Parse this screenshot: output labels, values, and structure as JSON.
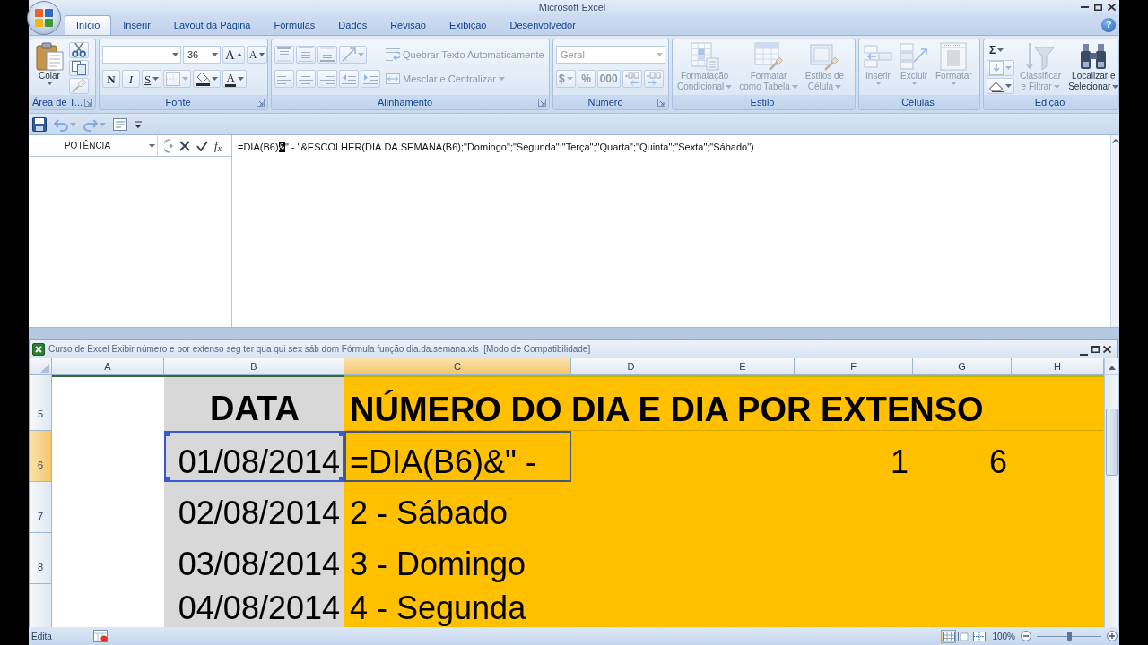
{
  "app": {
    "title": "Microsoft Excel",
    "help": "?"
  },
  "tabs": [
    {
      "label": "Início",
      "selected": true
    },
    {
      "label": "Inserir",
      "selected": false
    },
    {
      "label": "Layout da Página",
      "selected": false
    },
    {
      "label": "Fórmulas",
      "selected": false
    },
    {
      "label": "Dados",
      "selected": false
    },
    {
      "label": "Revisão",
      "selected": false
    },
    {
      "label": "Exibição",
      "selected": false
    },
    {
      "label": "Desenvolvedor",
      "selected": false
    }
  ],
  "ribbon": {
    "groups": [
      {
        "label": "Área de T...",
        "launcher": true,
        "sections": [
          [
            [
              {
                "kind": "large",
                "lines": [
                  "Colar"
                ],
                "caret": true,
                "disabled": false
              }
            ]
          ],
          [
            [
              {
                "kind": "icon",
                "caret": false,
                "disabled": false
              }
            ],
            [
              {
                "kind": "icon",
                "caret": false,
                "disabled": false
              }
            ],
            [
              {
                "kind": "icon",
                "caret": false,
                "disabled": true
              }
            ]
          ]
        ]
      },
      {
        "label": "Fonte",
        "launcher": true,
        "sections": [
          [
            [
              {
                "kind": "field",
                "caret": true,
                "disabled": false
              },
              {
                "kind": "field",
                "value": "36",
                "caret": true,
                "disabled": false
              },
              {
                "kind": "grow",
                "label": "A",
                "caret": false,
                "disabled": false
              },
              {
                "kind": "shrink",
                "label": "A",
                "caret": false,
                "disabled": false
              }
            ],
            [
              {
                "kind": "bold",
                "label": "N",
                "caret": false,
                "disabled": false
              },
              {
                "kind": "italic",
                "label": "I",
                "caret": false,
                "disabled": false
              },
              {
                "kind": "underline",
                "label": "S",
                "caret": true,
                "disabled": false
              },
              {
                "kind": "icon",
                "caret": true,
                "disabled": true
              },
              {
                "kind": "icon",
                "caret": true,
                "disabled": false
              },
              {
                "kind": "font-color",
                "label": "A",
                "caret": true,
                "disabled": false
              }
            ]
          ]
        ]
      },
      {
        "label": "Alinhamento",
        "launcher": true,
        "sections": [
          [
            [
              {
                "kind": "icon",
                "caret": false,
                "disabled": true
              },
              {
                "kind": "icon",
                "caret": false,
                "disabled": true
              },
              {
                "kind": "icon",
                "caret": false,
                "disabled": true
              },
              {
                "kind": "icon",
                "caret": true,
                "disabled": true
              }
            ],
            [
              {
                "kind": "icon",
                "caret": false,
                "disabled": true
              },
              {
                "kind": "icon",
                "caret": false,
                "disabled": true
              },
              {
                "kind": "icon",
                "caret": false,
                "disabled": true
              },
              {
                "kind": "icon",
                "caret": false,
                "disabled": true
              },
              {
                "kind": "icon",
                "caret": false,
                "disabled": true
              }
            ]
          ],
          [
            [
              {
                "kind": "small",
                "label": "Quebrar Texto Automaticamente",
                "caret": false,
                "disabled": true
              }
            ],
            [
              {
                "kind": "small",
                "label": "Mesclar e Centralizar",
                "caret": true,
                "disabled": true
              }
            ]
          ]
        ]
      },
      {
        "label": "Número",
        "launcher": true,
        "sections": [
          [
            [
              {
                "kind": "field",
                "value": "Geral",
                "caret": true,
                "disabled": true
              }
            ],
            [
              {
                "kind": "char",
                "label": "$",
                "caret": true,
                "disabled": true
              },
              {
                "kind": "char",
                "label": "%",
                "caret": false,
                "disabled": true
              },
              {
                "kind": "char",
                "label": "000",
                "caret": false,
                "disabled": true
              },
              {
                "kind": "icon",
                "caret": false,
                "disabled": true
              },
              {
                "kind": "icon",
                "caret": false,
                "disabled": true
              }
            ]
          ]
        ]
      },
      {
        "label": "Estilo",
        "launcher": false,
        "sections": [
          [
            [
              {
                "kind": "large",
                "lines": [
                  "Formatação",
                  "Condicional"
                ],
                "caret": true,
                "disabled": true
              }
            ]
          ],
          [
            [
              {
                "kind": "large",
                "lines": [
                  "Formatar",
                  "como Tabela"
                ],
                "caret": true,
                "disabled": true
              }
            ]
          ],
          [
            [
              {
                "kind": "large",
                "lines": [
                  "Estilos de",
                  "Célula"
                ],
                "caret": true,
                "disabled": true
              }
            ]
          ]
        ]
      },
      {
        "label": "Células",
        "launcher": false,
        "sections": [
          [
            [
              {
                "kind": "large",
                "lines": [
                  "Inserir"
                ],
                "caret": true,
                "disabled": true
              }
            ]
          ],
          [
            [
              {
                "kind": "large",
                "lines": [
                  "Excluir"
                ],
                "caret": true,
                "disabled": true
              }
            ]
          ],
          [
            [
              {
                "kind": "large",
                "lines": [
                  "Formatar"
                ],
                "caret": true,
                "disabled": true
              }
            ]
          ]
        ]
      },
      {
        "label": "Edição",
        "launcher": false,
        "sections": [
          [
            [
              {
                "kind": "char",
                "label": "Σ",
                "caret": true,
                "disabled": false
              }
            ],
            [
              {
                "kind": "icon",
                "caret": true,
                "disabled": true
              }
            ],
            [
              {
                "kind": "icon",
                "caret": true,
                "disabled": false
              }
            ]
          ],
          [
            [
              {
                "kind": "large",
                "lines": [
                  "Classificar",
                  "e Filtrar"
                ],
                "caret": true,
                "disabled": true
              }
            ]
          ],
          [
            [
              {
                "kind": "large",
                "lines": [
                  "Localizar e",
                  "Selecionar"
                ],
                "caret": true,
                "disabled": false
              }
            ]
          ]
        ]
      }
    ]
  },
  "quick_access": [
    {
      "caret": false,
      "disabled": false
    },
    {
      "caret": true,
      "disabled": true
    },
    {
      "caret": true,
      "disabled": true
    },
    {
      "caret": false,
      "disabled": false
    }
  ],
  "formula_bar": {
    "name_box": "POTÊNCIA",
    "function_button": "f$_{x}$",
    "formula_parts": [
      {
        "text": "=DIA(B6)",
        "selected": false
      },
      {
        "text": "&",
        "selected": true
      },
      {
        "text": "\" - \"&ESCOLHER(DIA.DA.SEMANA(B6);\"Domingo\";\"Segunda\";\"Terça\";\"Quarta\";\"Quinta\";\"Sexta\";\"Sábado\")",
        "selected": false
      }
    ]
  },
  "workbook": {
    "title": "Curso de Excel Exibir número e por extenso seg ter qua qui sex sáb dom Fórmula função dia.da.semana.xls  [Modo de Compatibilidade]",
    "columns": [
      {
        "label": "A",
        "selected": false
      },
      {
        "label": "B",
        "selected": false
      },
      {
        "label": "C",
        "selected": true
      },
      {
        "label": "D",
        "selected": false
      },
      {
        "label": "E",
        "selected": false
      },
      {
        "label": "F",
        "selected": false
      },
      {
        "label": "G",
        "selected": false
      },
      {
        "label": "H",
        "selected": false
      }
    ],
    "fills": [
      {
        "color": "#d8d8d8"
      },
      {
        "color": "#ffc000"
      }
    ],
    "rows": [
      {
        "header": "5",
        "selected": false,
        "cells": [
          {
            "kind": "empty",
            "selected": false,
            "referenced": false
          },
          {
            "kind": "title",
            "text": "DATA",
            "selected": false,
            "referenced": false
          },
          {
            "kind": "heading",
            "text": "NÚMERO DO DIA E DIA POR EXTENSO",
            "selected": false,
            "referenced": false
          }
        ]
      },
      {
        "header": "6",
        "selected": true,
        "cells": [
          {
            "kind": "empty",
            "selected": false,
            "referenced": false
          },
          {
            "kind": "date",
            "text": "01/08/2014",
            "selected": false,
            "referenced": true
          },
          {
            "kind": "formula",
            "text": "=DIA(B6)&\" -",
            "selected": true,
            "referenced": false
          },
          {
            "kind": "empty",
            "selected": false,
            "referenced": false
          },
          {
            "kind": "empty",
            "selected": false,
            "referenced": false
          },
          {
            "kind": "number",
            "text": "1",
            "selected": false,
            "referenced": false
          },
          {
            "kind": "number",
            "text": "6",
            "selected": false,
            "referenced": false
          }
        ]
      },
      {
        "header": "7",
        "selected": false,
        "cells": [
          {
            "kind": "empty",
            "selected": false,
            "referenced": false
          },
          {
            "kind": "date",
            "text": "02/08/2014",
            "selected": false,
            "referenced": false
          },
          {
            "kind": "text",
            "text": "2 - Sábado",
            "selected": false,
            "referenced": false
          }
        ]
      },
      {
        "header": "8",
        "selected": false,
        "cells": [
          {
            "kind": "empty",
            "selected": false,
            "referenced": false
          },
          {
            "kind": "date",
            "text": "03/08/2014",
            "selected": false,
            "referenced": false
          },
          {
            "kind": "text",
            "text": "3 - Domingo",
            "selected": false,
            "referenced": false
          }
        ]
      },
      {
        "selected": false,
        "cells": [
          {
            "kind": "empty",
            "selected": false,
            "referenced": false
          },
          {
            "kind": "date",
            "text": "04/08/2014",
            "selected": false,
            "referenced": false
          },
          {
            "kind": "text",
            "text": "4 - Segunda",
            "selected": false,
            "referenced": false
          }
        ]
      }
    ]
  },
  "status_bar": {
    "mode": "Edita",
    "views": [
      {
        "selected": true
      },
      {
        "selected": false
      },
      {
        "selected": false
      }
    ],
    "zoom": {
      "label": "100%",
      "level": 0.5
    }
  }
}
